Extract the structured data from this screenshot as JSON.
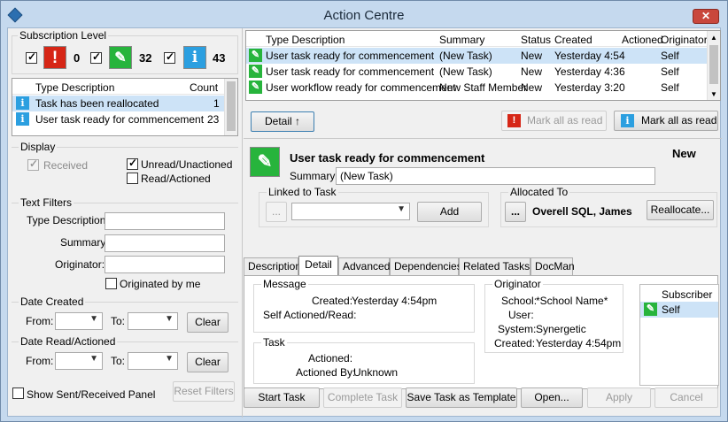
{
  "window": {
    "title": "Action Centre",
    "close_glyph": "✕"
  },
  "subscription": {
    "title": "Subscription Level",
    "levels": [
      {
        "icon": "exclamation-icon",
        "glyph": "!",
        "count": "0",
        "checked": true
      },
      {
        "icon": "pencil-icon",
        "glyph": "✎",
        "count": "32",
        "checked": true
      },
      {
        "icon": "info-icon",
        "glyph": "i",
        "count": "43",
        "checked": true
      }
    ]
  },
  "type_list": {
    "columns": {
      "type": "Type Description",
      "count": "Count"
    },
    "rows": [
      {
        "type": "Task has been reallocated",
        "count": "1",
        "selected": true
      },
      {
        "type": "User task ready for commencement",
        "count": "23",
        "selected": false
      }
    ]
  },
  "display": {
    "title": "Display",
    "received": "Received",
    "unread": "Unread/Unactioned",
    "read": "Read/Actioned"
  },
  "text_filters": {
    "title": "Text Filters",
    "type_description": "Type Description:",
    "summary": "Summary:",
    "originator": "Originator:",
    "originated_by_me": "Originated by me"
  },
  "date_created": {
    "title": "Date Created",
    "from": "From:",
    "to": "To:",
    "clear": "Clear"
  },
  "date_read": {
    "title": "Date Read/Actioned",
    "from": "From:",
    "to": "To:",
    "clear": "Clear"
  },
  "bottom_left": {
    "show_panel": "Show Sent/Received Panel",
    "reset": "Reset Filters"
  },
  "tasks": {
    "columns": {
      "type": "Type Description",
      "summary": "Summary",
      "status": "Status",
      "created": "Created",
      "actioned": "Actioned",
      "originator": "Originator"
    },
    "rows": [
      {
        "type": "User task ready for commencement",
        "summary": "(New Task)",
        "status": "New",
        "created": "Yesterday 4:54",
        "actioned": "",
        "originator": "Self",
        "selected": true
      },
      {
        "type": "User task ready for commencement",
        "summary": "(New Task)",
        "status": "New",
        "created": "Yesterday 4:36",
        "actioned": "",
        "originator": "Self",
        "selected": false
      },
      {
        "type": "User workflow ready for commencement",
        "summary": "New Staff Member",
        "status": "New",
        "created": "Yesterday 3:20",
        "actioned": "",
        "originator": "Self",
        "selected": false
      }
    ]
  },
  "task_buttons": {
    "detail": "Detail ↑",
    "mark_all_read_1": "Mark all as read",
    "mark_all_read_2": "Mark all as read"
  },
  "detail": {
    "title": "User task ready for commencement",
    "status": "New",
    "summary_label": "Summary:",
    "summary_value": "(New Task)",
    "linked_title": "Linked to Task",
    "ellipsis": "...",
    "add": "Add",
    "allocated_title": "Allocated To",
    "allocated_value": "Overell SQL, James",
    "reallocate": "Reallocate..."
  },
  "tabs": [
    "Description",
    "Detail",
    "Advanced",
    "Dependencies",
    "Related Tasks",
    "DocMan"
  ],
  "detail_tab": {
    "message_title": "Message",
    "created_label": "Created:",
    "created_value": "Yesterday 4:54pm",
    "self_actioned_label": "Self Actioned/Read:",
    "task_title": "Task",
    "actioned_label": "Actioned:",
    "actioned_by_label": "Actioned By:",
    "actioned_by_value": "Unknown",
    "originator_title": "Originator",
    "school_label": "School:",
    "school_value": "*School Name*",
    "user_label": "User:",
    "system_label": "System:",
    "system_value": "Synergetic",
    "orig_created_label": "Created:",
    "orig_created_value": "Yesterday 4:54pm",
    "subscriber_header": "Subscriber",
    "subscriber_row": "Self"
  },
  "footer": {
    "start": "Start Task",
    "complete": "Complete Task",
    "save_template": "Save Task as Template",
    "open": "Open...",
    "apply": "Apply",
    "cancel": "Cancel"
  }
}
